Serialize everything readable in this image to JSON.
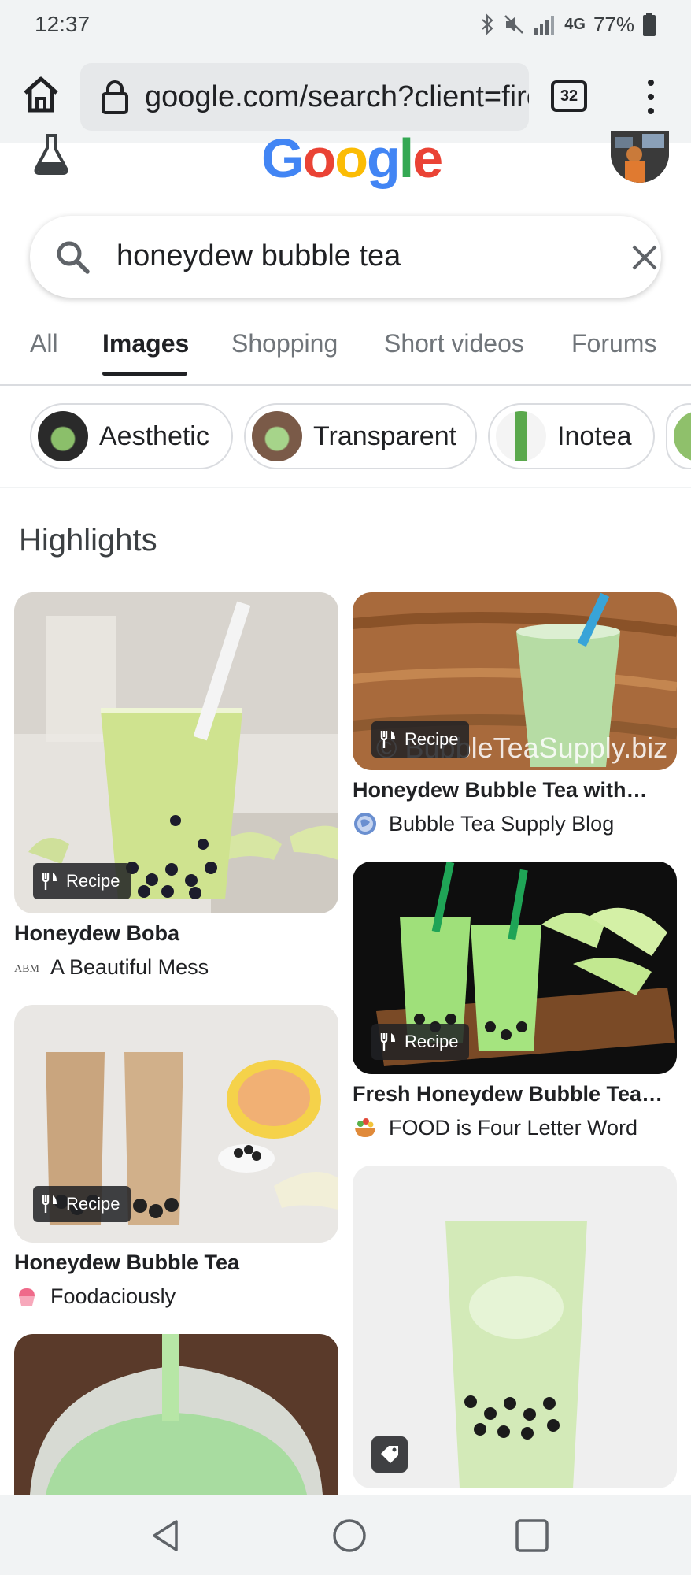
{
  "status": {
    "time": "12:37",
    "network": "4G",
    "battery": "77%"
  },
  "browser": {
    "url": "google.com/search?client=firef",
    "tab_count": "32"
  },
  "header": {
    "logo_text": "Google"
  },
  "search": {
    "query": "honeydew bubble tea"
  },
  "tabs": [
    {
      "label": "All"
    },
    {
      "label": "Images",
      "active": true
    },
    {
      "label": "Shopping"
    },
    {
      "label": "Short videos"
    },
    {
      "label": "Forums"
    }
  ],
  "chips": [
    {
      "label": "Aesthetic"
    },
    {
      "label": "Transparent"
    },
    {
      "label": "Inotea"
    }
  ],
  "section_title": "Highlights",
  "results": [
    {
      "title": "Honeydew Boba",
      "source": "A Beautiful Mess",
      "badge": "Recipe"
    },
    {
      "title": "Honeydew Bubble Tea with…",
      "source": "Bubble Tea Supply Blog",
      "badge": "Recipe",
      "watermark": "© BubbleTeaSupply.biz"
    },
    {
      "title": "Fresh Honeydew Bubble Tea…",
      "source": "FOOD is Four Letter Word",
      "badge": "Recipe"
    },
    {
      "title": "Honeydew Bubble Tea",
      "source": "Foodaciously",
      "badge": "Recipe"
    }
  ],
  "colors": {
    "google_blue": "#4285F4",
    "google_red": "#EA4335",
    "google_yellow": "#FBBC05",
    "google_green": "#34A853"
  }
}
